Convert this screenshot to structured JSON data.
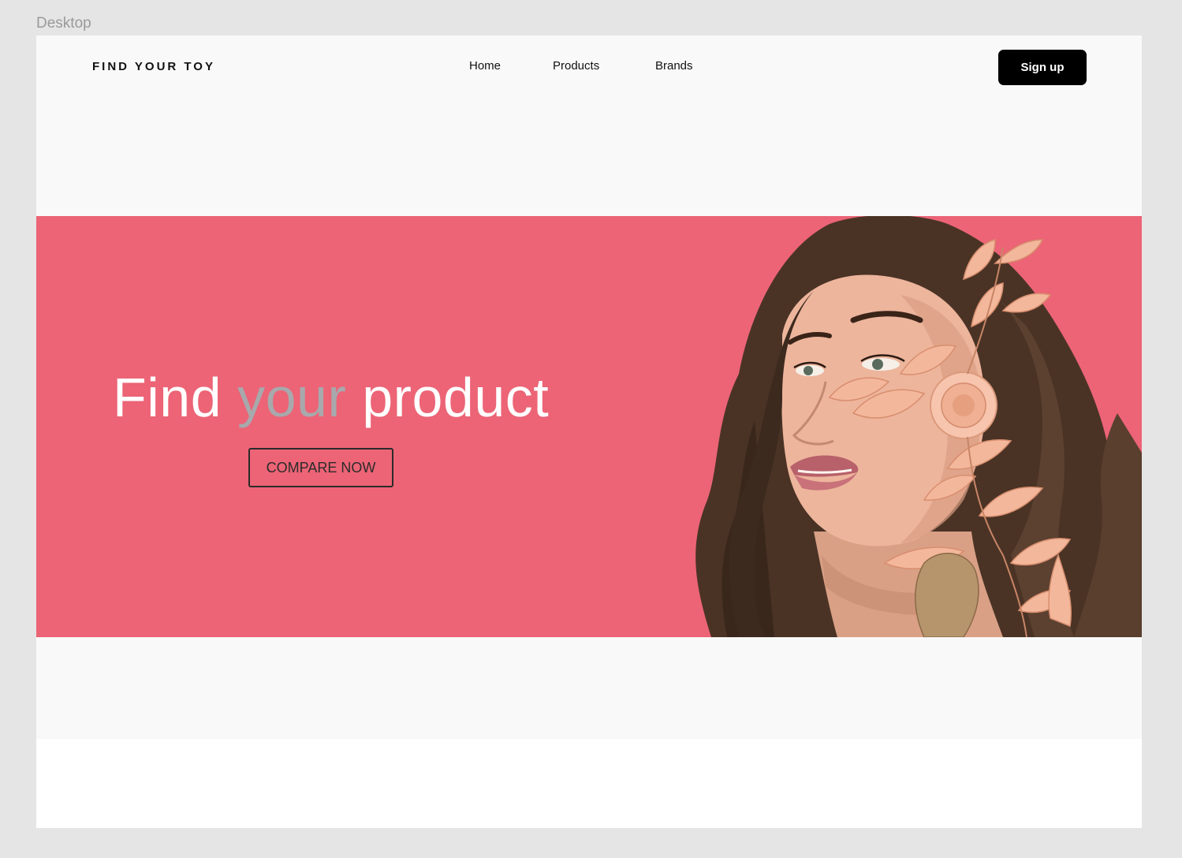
{
  "canvas": {
    "frame_label": "Desktop"
  },
  "header": {
    "logo": "FIND YOUR TOY",
    "nav": [
      {
        "label": "Home"
      },
      {
        "label": "Products"
      },
      {
        "label": "Brands"
      }
    ],
    "signup_label": "Sign up"
  },
  "hero": {
    "title_part1": "Find ",
    "title_accent": "your",
    "title_part2": " product",
    "cta_label": "COMPARE NOW",
    "image_description_icon": "woman-portrait-with-leaves-image"
  },
  "colors": {
    "hero_bg": "#ec6476",
    "accent_word": "#a7a9ac",
    "signup_bg": "#000000",
    "page_bg": "#f9f9f9",
    "canvas_bg": "#e5e5e5"
  }
}
